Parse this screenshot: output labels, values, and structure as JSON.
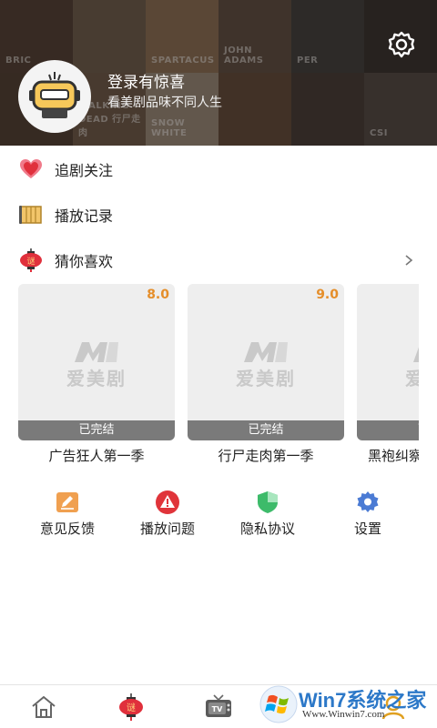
{
  "header": {
    "posters": [
      "BRIC",
      "",
      "SPARTACUS",
      "JOHN ADAMS",
      "PER",
      "",
      "",
      "WALKING DEAD 行尸走肉",
      "SNOW WHITE",
      "",
      "",
      "CSI"
    ],
    "login_title": "登录有惊喜",
    "login_subtitle": "看美剧品味不同人生",
    "avatar_icon": "robot-avatar-icon",
    "settings_icon": "gear-icon"
  },
  "menu": {
    "follow": {
      "label": "追剧关注",
      "icon": "heart-icon",
      "color": "#e8405a"
    },
    "history": {
      "label": "播放记录",
      "icon": "film-icon",
      "color": "#d9a54a"
    },
    "recommend": {
      "label": "猜你喜欢",
      "icon": "lantern-icon",
      "color": "#e0303c"
    }
  },
  "cards": [
    {
      "rating": "8.0",
      "status": "已完结",
      "title": "广告狂人第一季",
      "logo": "爱美剧"
    },
    {
      "rating": "9.0",
      "status": "已完结",
      "title": "行尸走肉第一季",
      "logo": "爱美剧"
    },
    {
      "rating": "",
      "status": "已完结",
      "title": "黑袍纠察队",
      "logo": "爱美剧"
    }
  ],
  "actions": [
    {
      "label": "意见反馈",
      "icon": "edit-icon",
      "color": "#f0a050"
    },
    {
      "label": "播放问题",
      "icon": "warning-icon",
      "color": "#e0343a"
    },
    {
      "label": "隐私协议",
      "icon": "shield-icon",
      "color": "#3dbb6a"
    },
    {
      "label": "设置",
      "icon": "gear-icon",
      "color": "#4b7bd4"
    }
  ],
  "nav": [
    {
      "icon": "home-icon"
    },
    {
      "icon": "lantern-icon"
    },
    {
      "icon": "tv-icon"
    },
    {
      "icon": "profile-icon"
    }
  ],
  "watermark": {
    "text": "Win7系统之家",
    "url": "Www.Winwin7.com"
  }
}
